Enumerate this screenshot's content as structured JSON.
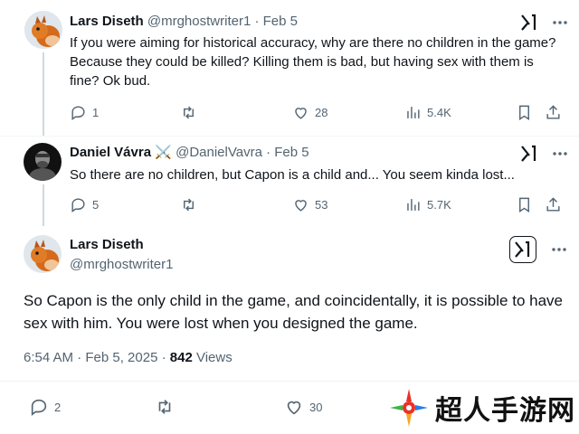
{
  "tweets": [
    {
      "name": "Lars Diseth",
      "handle": "@mrghostwriter1",
      "date": "Feb 5",
      "text": "If you were aiming for historical accuracy, why are there no children in the game? Because they could be killed? Killing them is bad, but having sex with them is fine? Ok bud.",
      "replies": "1",
      "likes": "28",
      "views": "5.4K"
    },
    {
      "name": "Daniel Vávra",
      "name_emoji": "⚔️",
      "handle": "@DanielVavra",
      "date": "Feb 5",
      "text": "So there are no children, but Capon is a child and... You seem kinda lost...",
      "replies": "5",
      "likes": "53",
      "views": "5.7K"
    }
  ],
  "focus": {
    "name": "Lars Diseth",
    "handle": "@mrghostwriter1",
    "text": "So Capon is the only child in the game, and coincidentally, it is possible to have sex with him. You were lost when you designed the game.",
    "time": "6:54 AM · Feb 5, 2025 · ",
    "views_count": "842",
    "views_label": " Views",
    "replies": "2",
    "likes": "30"
  },
  "separator": " · ",
  "watermark": {
    "text": "超人手游网"
  },
  "colors": {
    "text": "#0f1419",
    "muted": "#536471",
    "divider": "#eff3f4"
  }
}
